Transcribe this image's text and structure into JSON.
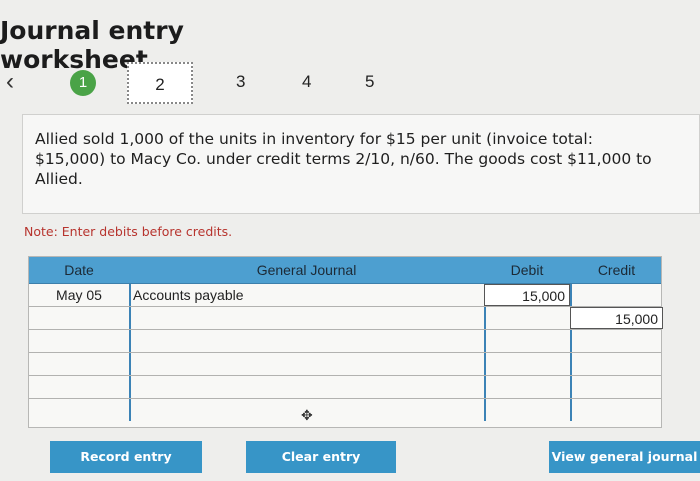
{
  "header": {
    "title": "Journal entry worksheet"
  },
  "stepper": {
    "back_icon": "‹",
    "steps": [
      "1",
      "2",
      "3",
      "4",
      "5"
    ],
    "current": "2"
  },
  "prompt": {
    "text": "Allied sold 1,000 of the units in inventory for $15 per unit (invoice total: $15,000) to Macy Co. under credit terms 2/10, n/60. The goods cost $11,000 to Allied."
  },
  "note": "Note: Enter debits before credits.",
  "table": {
    "columns": [
      "Date",
      "General Journal",
      "Debit",
      "Credit"
    ],
    "rows": [
      {
        "date": "May 05",
        "account": "Accounts payable",
        "debit": "15,000",
        "credit": ""
      },
      {
        "date": "",
        "account": "",
        "debit": "",
        "credit": "15,000"
      },
      {
        "date": "",
        "account": "",
        "debit": "",
        "credit": ""
      },
      {
        "date": "",
        "account": "",
        "debit": "",
        "credit": ""
      },
      {
        "date": "",
        "account": "",
        "debit": "",
        "credit": ""
      },
      {
        "date": "",
        "account": "",
        "debit": "",
        "credit": ""
      }
    ]
  },
  "buttons": {
    "record": "Record entry",
    "clear": "Clear entry",
    "view": "View general journal"
  },
  "colors": {
    "accent": "#3795c7",
    "header": "#4d9fd0",
    "done_step": "#4aa347",
    "note": "#b7342e"
  }
}
